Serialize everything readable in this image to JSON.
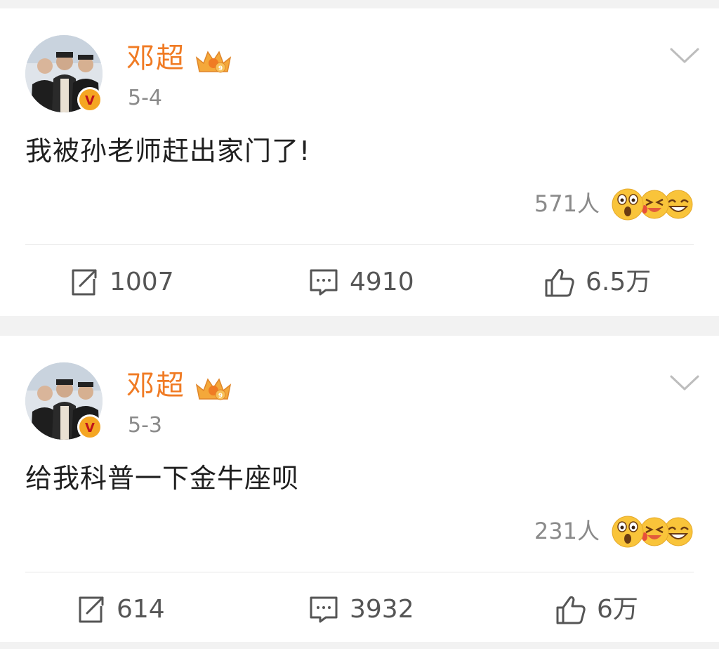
{
  "colors": {
    "username": "#f07b24",
    "date": "#8a8a8a",
    "action_text": "#555555",
    "badge": "#f5a623"
  },
  "posts": [
    {
      "username": "邓超",
      "date": "5-4",
      "text": "我被孙老师赶出家门了!",
      "reaction_count": "571人",
      "reposts": "1007",
      "comments": "4910",
      "likes": "6.5万"
    },
    {
      "username": "邓超",
      "date": "5-3",
      "text": "给我科普一下金牛座呗",
      "reaction_count": "231人",
      "reposts": "614",
      "comments": "3932",
      "likes": "6万"
    }
  ],
  "icons": {
    "verified": "verified-v-icon",
    "vip": "vip-crown-icon",
    "menu": "chevron-down-icon",
    "repost": "repost-icon",
    "comment": "comment-icon",
    "like": "thumbs-up-icon",
    "reactions": [
      "surprised-emoji-icon",
      "laughing-crying-emoji-icon",
      "grinning-emoji-icon"
    ]
  }
}
